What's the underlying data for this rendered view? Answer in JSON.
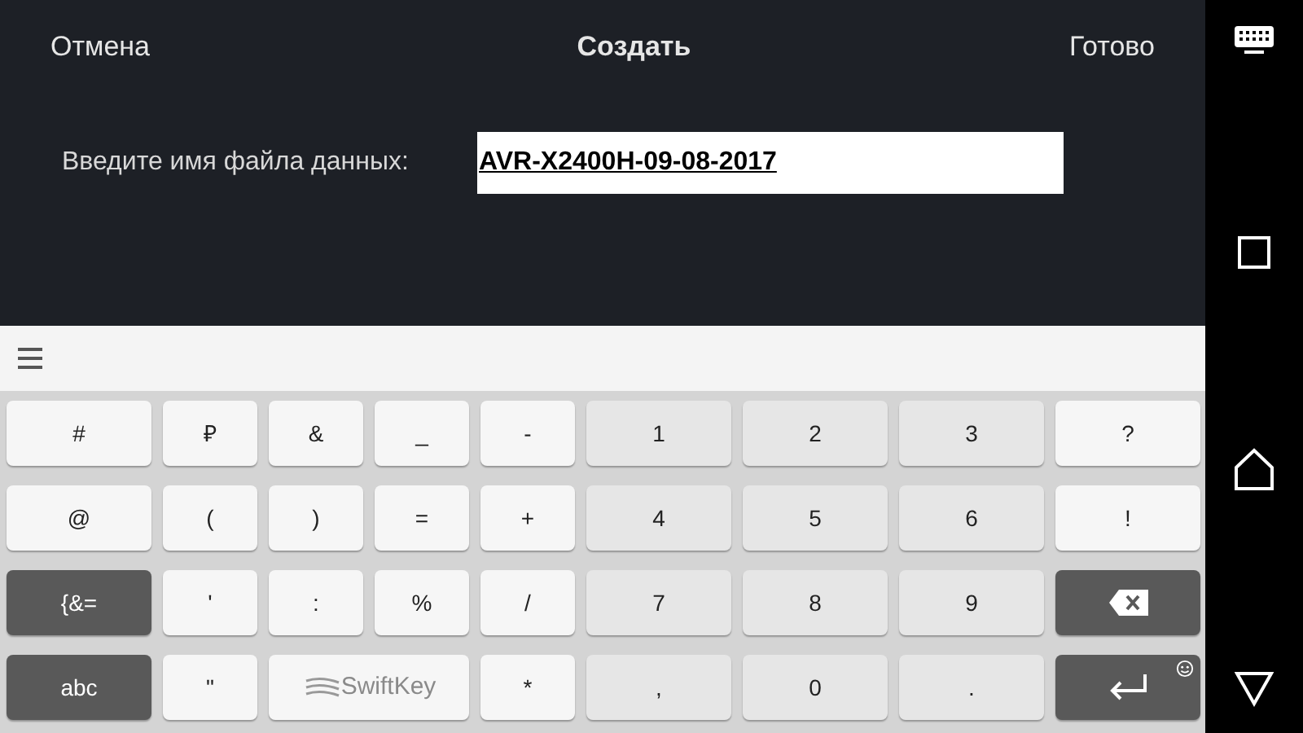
{
  "header": {
    "cancel": "Отмена",
    "title": "Создать",
    "done": "Готово"
  },
  "filename": {
    "label": "Введите имя файла данных:",
    "value": "AVR-X2400H-09-08-2017"
  },
  "keyboard": {
    "rows": [
      [
        {
          "kind": "symbol",
          "label": "#"
        },
        {
          "kind": "symbol",
          "label": "₽"
        },
        {
          "kind": "symbol",
          "label": "&"
        },
        {
          "kind": "symbol",
          "label": "_"
        },
        {
          "kind": "symbol",
          "label": "-"
        },
        {
          "kind": "digit",
          "label": "1"
        },
        {
          "kind": "digit",
          "label": "2"
        },
        {
          "kind": "digit",
          "label": "3"
        },
        {
          "kind": "symbol",
          "label": "?"
        }
      ],
      [
        {
          "kind": "symbol",
          "label": "@"
        },
        {
          "kind": "symbol",
          "label": "("
        },
        {
          "kind": "symbol",
          "label": ")"
        },
        {
          "kind": "symbol",
          "label": "="
        },
        {
          "kind": "symbol",
          "label": "+"
        },
        {
          "kind": "digit",
          "label": "4"
        },
        {
          "kind": "digit",
          "label": "5"
        },
        {
          "kind": "digit",
          "label": "6"
        },
        {
          "kind": "symbol",
          "label": "!"
        }
      ],
      [
        {
          "kind": "function",
          "label": "{&="
        },
        {
          "kind": "symbol",
          "label": "'"
        },
        {
          "kind": "symbol",
          "label": ":"
        },
        {
          "kind": "symbol",
          "label": "%"
        },
        {
          "kind": "symbol",
          "label": "/"
        },
        {
          "kind": "digit",
          "label": "7"
        },
        {
          "kind": "digit",
          "label": "8"
        },
        {
          "kind": "digit",
          "label": "9"
        },
        {
          "kind": "backspace"
        }
      ]
    ],
    "bottom_row": {
      "left_keys": [
        {
          "kind": "function",
          "label": "abc"
        },
        {
          "kind": "symbol",
          "label": "\""
        }
      ],
      "space_bar": {
        "label": "SwiftKey"
      },
      "right_keys": [
        {
          "kind": "symbol",
          "label": "*"
        },
        {
          "kind": "digit",
          "label": ","
        },
        {
          "kind": "digit",
          "label": "0"
        },
        {
          "kind": "digit",
          "label": "."
        },
        {
          "kind": "enter"
        }
      ]
    }
  }
}
